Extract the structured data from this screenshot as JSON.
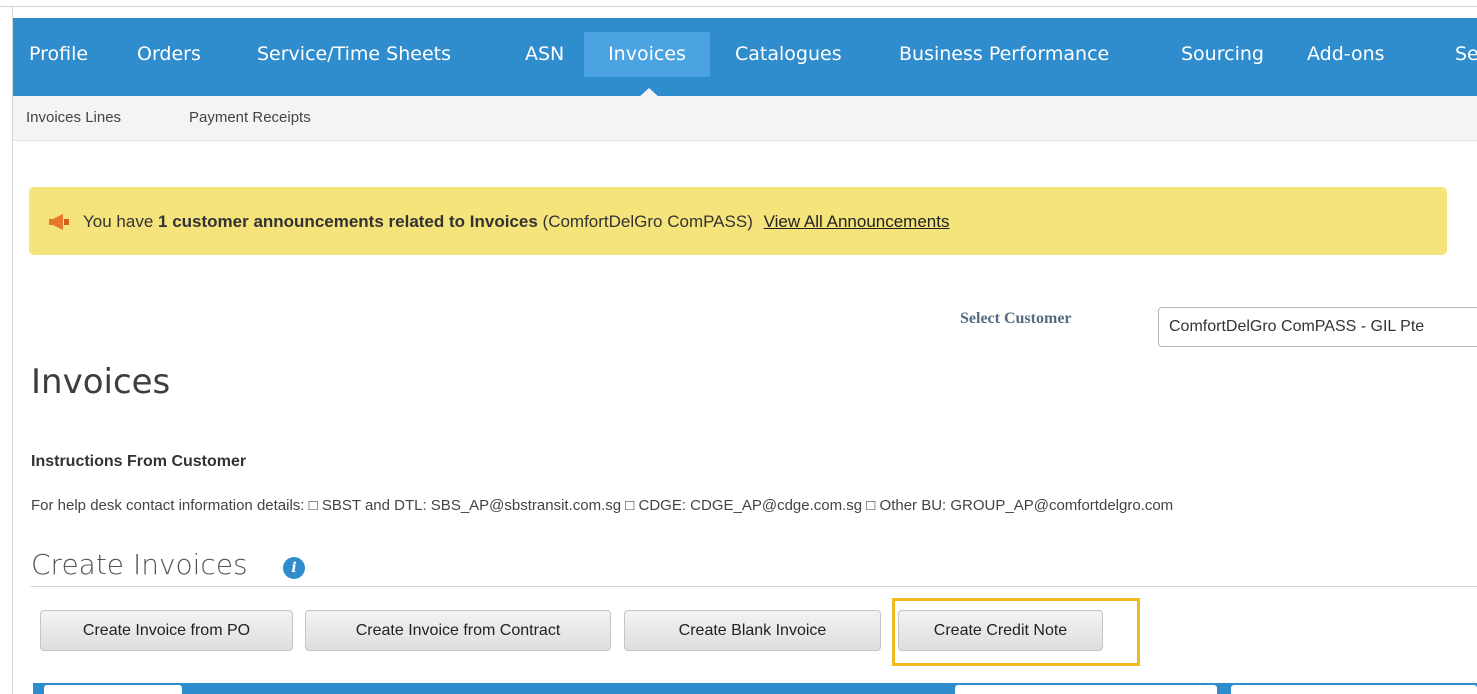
{
  "topnav": {
    "tabs": [
      {
        "label": "Profile"
      },
      {
        "label": "Orders"
      },
      {
        "label": "Service/Time Sheets"
      },
      {
        "label": "ASN"
      },
      {
        "label": "Invoices",
        "active": true
      },
      {
        "label": "Catalogues"
      },
      {
        "label": "Business Performance"
      },
      {
        "label": "Sourcing"
      },
      {
        "label": "Add-ons"
      },
      {
        "label": "Se"
      }
    ]
  },
  "subnav": {
    "items": [
      {
        "label": "Invoices Lines"
      },
      {
        "label": "Payment Receipts"
      }
    ]
  },
  "announcement": {
    "icon": "megaphone-icon",
    "prefix": "You have",
    "bold_text": "1 customer announcements related to Invoices",
    "customer": "(ComfortDelGro ComPASS)",
    "link": "View All Announcements"
  },
  "customer_select": {
    "label": "Select Customer",
    "value": "ComfortDelGro ComPASS - GIL Pte"
  },
  "page_title": "Invoices",
  "instructions": {
    "heading": "Instructions From Customer",
    "body": "For help desk contact information details: □ SBST and DTL: SBS_AP@sbstransit.com.sg □ CDGE: CDGE_AP@cdge.com.sg □ Other BU: GROUP_AP@comfortdelgro.com"
  },
  "create_section": {
    "title": "Create Invoices",
    "info_icon": "info-icon",
    "buttons": [
      {
        "label": "Create Invoice from PO"
      },
      {
        "label": "Create Invoice from Contract"
      },
      {
        "label": "Create Blank Invoice"
      },
      {
        "label": "Create Credit Note",
        "highlighted": true
      }
    ]
  },
  "colors": {
    "nav_blue": "#2f8ccd",
    "active_tab": "#4ba4e1",
    "announcement_bg": "#f5e37c",
    "highlight_border": "#f3b91c"
  }
}
